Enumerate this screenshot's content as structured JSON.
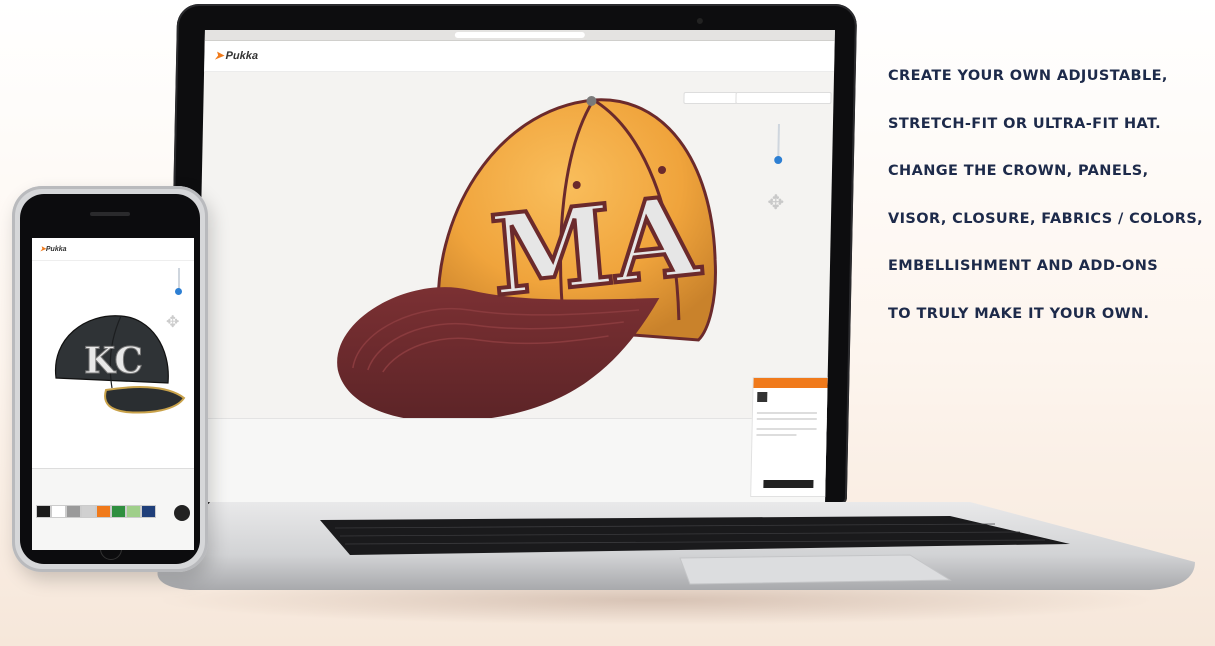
{
  "promo_lines": [
    "CREATE YOUR OWN ADJUSTABLE,",
    "STRETCH-FIT OR ULTRA-FIT HAT.",
    "CHANGE THE CROWN, PANELS,",
    "VISOR, CLOSURE, FABRICS / COLORS,",
    "EMBELLISHMENT AND ADD-ONS",
    "TO TRULY MAKE IT YOUR OWN."
  ],
  "laptop": {
    "logo": "Pukka",
    "hat_logo": "MA",
    "colors": {
      "crown": "#f5a93f",
      "visor": "#6b2a2c",
      "trim": "#6b2a2c",
      "accent": "#f07a1b"
    }
  },
  "phone": {
    "logo": "Pukka",
    "hat_logo": "KC",
    "swatch_colors": [
      "#1b1b1b",
      "#ffffff",
      "#9a9a9a",
      "#d0d0d0",
      "#f07a1b",
      "#2f8f3f",
      "#9fcf8a",
      "#1f3f7a"
    ]
  }
}
